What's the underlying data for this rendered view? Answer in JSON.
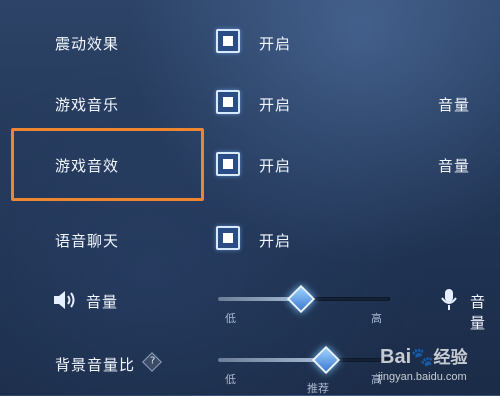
{
  "settings": [
    {
      "label": "震动效果",
      "option": "开启",
      "extra": ""
    },
    {
      "label": "游戏音乐",
      "option": "开启",
      "extra": "音量"
    },
    {
      "label": "游戏音效",
      "option": "开启",
      "extra": "音量"
    },
    {
      "label": "语音聊天",
      "option": "开启",
      "extra": ""
    }
  ],
  "volume": {
    "label": "音量",
    "low": "低",
    "high": "高",
    "level": 0.48,
    "mic_label": "音量"
  },
  "background_ratio": {
    "label": "背景音量比",
    "low": "低",
    "recommend": "推荐",
    "high": "高",
    "level": 0.63
  },
  "watermark": {
    "brand_prefix": "Bai",
    "brand_suffix": "经验",
    "url": "jingyan.baidu.com"
  },
  "colors": {
    "highlight_border": "#ee8630",
    "checkbox_fill": "#2b4d86"
  }
}
